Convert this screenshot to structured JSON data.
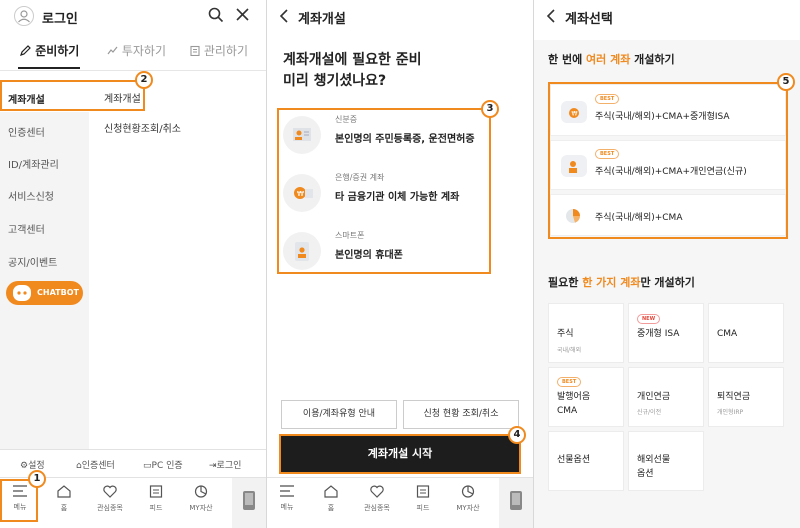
{
  "panel1": {
    "header_title": "로그인",
    "tabs": [
      {
        "label": "준비하기"
      },
      {
        "label": "투자하기"
      },
      {
        "label": "관리하기"
      }
    ],
    "side_menu": [
      "계좌개설",
      "인증센터",
      "ID/계좌관리",
      "서비스신청",
      "고객센터",
      "공지/이벤트"
    ],
    "sub_menu": [
      "계좌개설",
      "신청현황조회/취소"
    ],
    "chatbot_label": "CHATBOT",
    "utilities": [
      "설정",
      "인증센터",
      "PC 인증",
      "로그인"
    ]
  },
  "panel2": {
    "header_title": "계좌개설",
    "heading_line1": "계좌개설에 필요한 준비",
    "heading_line2": "미리 챙기셨나요?",
    "requirements": [
      {
        "small": "신분증",
        "main": "본인명의 주민등록증, 운전면허증"
      },
      {
        "small": "은행/증권 계좌",
        "main": "타 금융기관 이체 가능한 계좌"
      },
      {
        "small": "스마트폰",
        "main": "본인명의 휴대폰"
      }
    ],
    "btn_guide": "이용/계좌유형 안내",
    "btn_status": "신청 현황 조회/취소",
    "btn_start": "계좌개설 시작"
  },
  "panel3": {
    "header_title": "계좌선택",
    "multi_title_pre": "한 번에 ",
    "multi_title_hl": "여러 계좌",
    "multi_title_post": " 개설하기",
    "combos": [
      {
        "tag": "BEST",
        "text": "주식(국내/해외)+CMA+중개형ISA"
      },
      {
        "tag": "BEST",
        "text": "주식(국내/해외)+CMA+개인연금(신규)"
      },
      {
        "tag": "",
        "text": "주식(국내/해외)+CMA"
      }
    ],
    "single_title_pre": "필요한 ",
    "single_title_hl": "한 가지 계좌",
    "single_title_post": "만 개설하기",
    "tiles": [
      {
        "tag": "",
        "title": "주식",
        "title2": "",
        "sub": "국내/해외"
      },
      {
        "tag": "NEW",
        "title": "중개형 ISA",
        "title2": "",
        "sub": ""
      },
      {
        "tag": "",
        "title": "CMA",
        "title2": "",
        "sub": ""
      },
      {
        "tag": "BEST",
        "title": "발행어음",
        "title2": "CMA",
        "sub": ""
      },
      {
        "tag": "",
        "title": "개인연금",
        "title2": "",
        "sub": "신규/이전"
      },
      {
        "tag": "",
        "title": "퇴직연금",
        "title2": "",
        "sub": "개인형IRP"
      },
      {
        "tag": "",
        "title": "선물옵션",
        "title2": "",
        "sub": ""
      },
      {
        "tag": "",
        "title": "해외선물",
        "title2": "옵션",
        "sub": ""
      }
    ]
  },
  "bottom_nav": [
    "메뉴",
    "홈",
    "관심종목",
    "피드",
    "MY자산"
  ],
  "callouts": [
    "1",
    "2",
    "3",
    "4",
    "5"
  ],
  "colors": {
    "accent": "#f08a1f",
    "dark_button": "#1d1d1d"
  }
}
